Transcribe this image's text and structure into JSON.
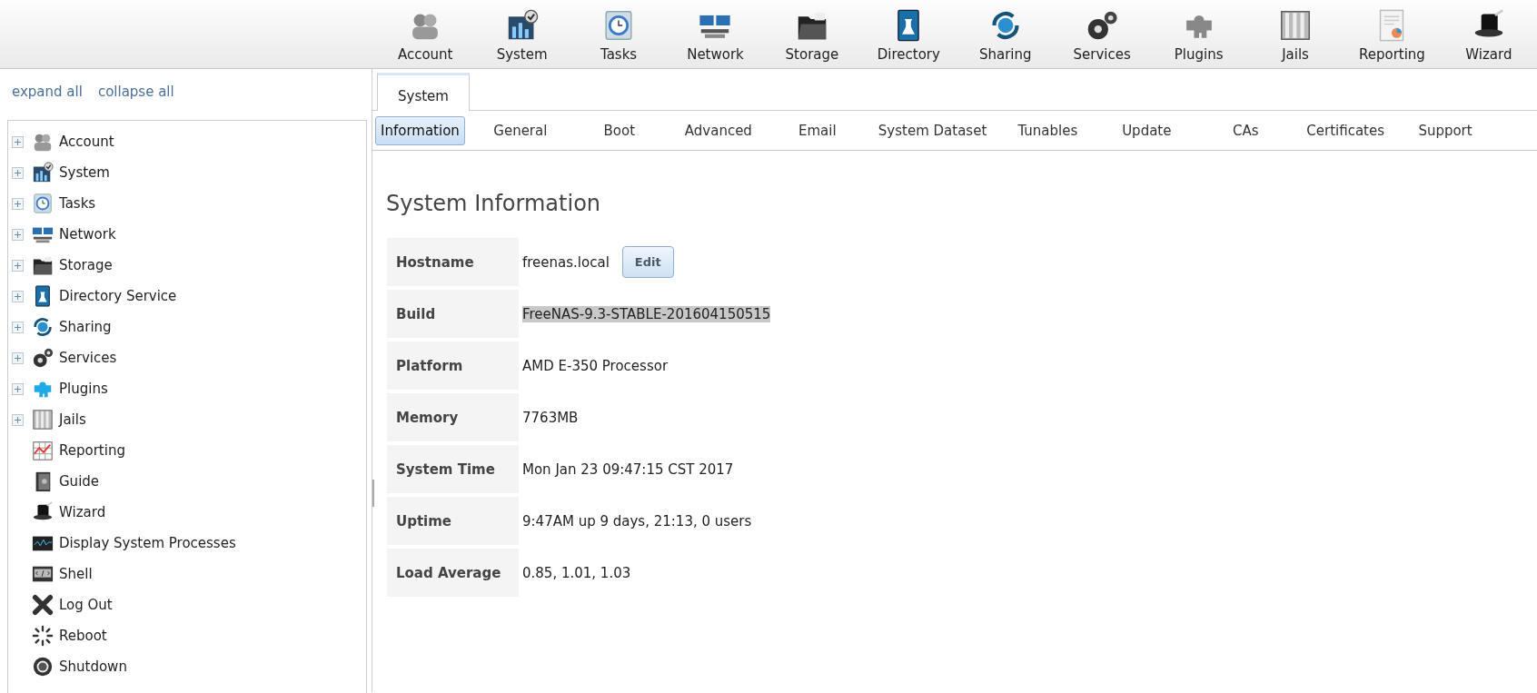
{
  "toolbar": [
    {
      "label": "Account"
    },
    {
      "label": "System"
    },
    {
      "label": "Tasks"
    },
    {
      "label": "Network"
    },
    {
      "label": "Storage"
    },
    {
      "label": "Directory"
    },
    {
      "label": "Sharing"
    },
    {
      "label": "Services"
    },
    {
      "label": "Plugins"
    },
    {
      "label": "Jails"
    },
    {
      "label": "Reporting"
    },
    {
      "label": "Wizard"
    }
  ],
  "sidebar": {
    "links": [
      "expand all",
      "collapse all"
    ],
    "tree": [
      {
        "label": "Account",
        "kind": "branch",
        "expanded": false
      },
      {
        "label": "System",
        "kind": "branch",
        "expanded": false
      },
      {
        "label": "Tasks",
        "kind": "branch",
        "expanded": false
      },
      {
        "label": "Network",
        "kind": "branch",
        "expanded": false
      },
      {
        "label": "Storage",
        "kind": "branch",
        "expanded": false
      },
      {
        "label": "Directory Service",
        "kind": "branch",
        "expanded": false
      },
      {
        "label": "Sharing",
        "kind": "branch",
        "expanded": false
      },
      {
        "label": "Services",
        "kind": "branch",
        "expanded": false
      },
      {
        "label": "Plugins",
        "kind": "branch",
        "expanded": false
      },
      {
        "label": "Jails",
        "kind": "branch",
        "expanded": false
      },
      {
        "label": "Reporting",
        "kind": "leaf"
      },
      {
        "label": "Guide",
        "kind": "leaf"
      },
      {
        "label": "Wizard",
        "kind": "leaf"
      },
      {
        "label": "Display System Processes",
        "kind": "leaf"
      },
      {
        "label": "Shell",
        "kind": "leaf"
      },
      {
        "label": "Log Out",
        "kind": "leaf"
      },
      {
        "label": "Reboot",
        "kind": "leaf"
      },
      {
        "label": "Shutdown",
        "kind": "leaf"
      }
    ]
  },
  "tabs": [
    {
      "label": "System",
      "selected": true
    }
  ],
  "subtabs": [
    {
      "label": "Information",
      "selected": true
    },
    {
      "label": "General",
      "selected": false
    },
    {
      "label": "Boot",
      "selected": false
    },
    {
      "label": "Advanced",
      "selected": false
    },
    {
      "label": "Email",
      "selected": false
    },
    {
      "label": "System Dataset",
      "selected": false
    },
    {
      "label": "Tunables",
      "selected": false
    },
    {
      "label": "Update",
      "selected": false
    },
    {
      "label": "CAs",
      "selected": false
    },
    {
      "label": "Certificates",
      "selected": false
    },
    {
      "label": "Support",
      "selected": false
    }
  ],
  "content": {
    "title": "System Information",
    "rows": [
      {
        "label": "Hostname",
        "value": "freenas.local",
        "highlighted": false,
        "button": "Edit"
      },
      {
        "label": "Build",
        "value": "FreeNAS-9.3-STABLE-201604150515",
        "highlighted": true
      },
      {
        "label": "Platform",
        "value": "AMD E-350 Processor",
        "highlighted": false
      },
      {
        "label": "Memory",
        "value": "7763MB",
        "highlighted": false
      },
      {
        "label": "System Time",
        "value": "Mon Jan 23 09:47:15 CST 2017",
        "highlighted": false
      },
      {
        "label": "Uptime",
        "value": "9:47AM up 9 days, 21:13, 0 users",
        "highlighted": false
      },
      {
        "label": "Load Average",
        "value": "0.85, 1.01, 1.03",
        "highlighted": false
      }
    ]
  }
}
